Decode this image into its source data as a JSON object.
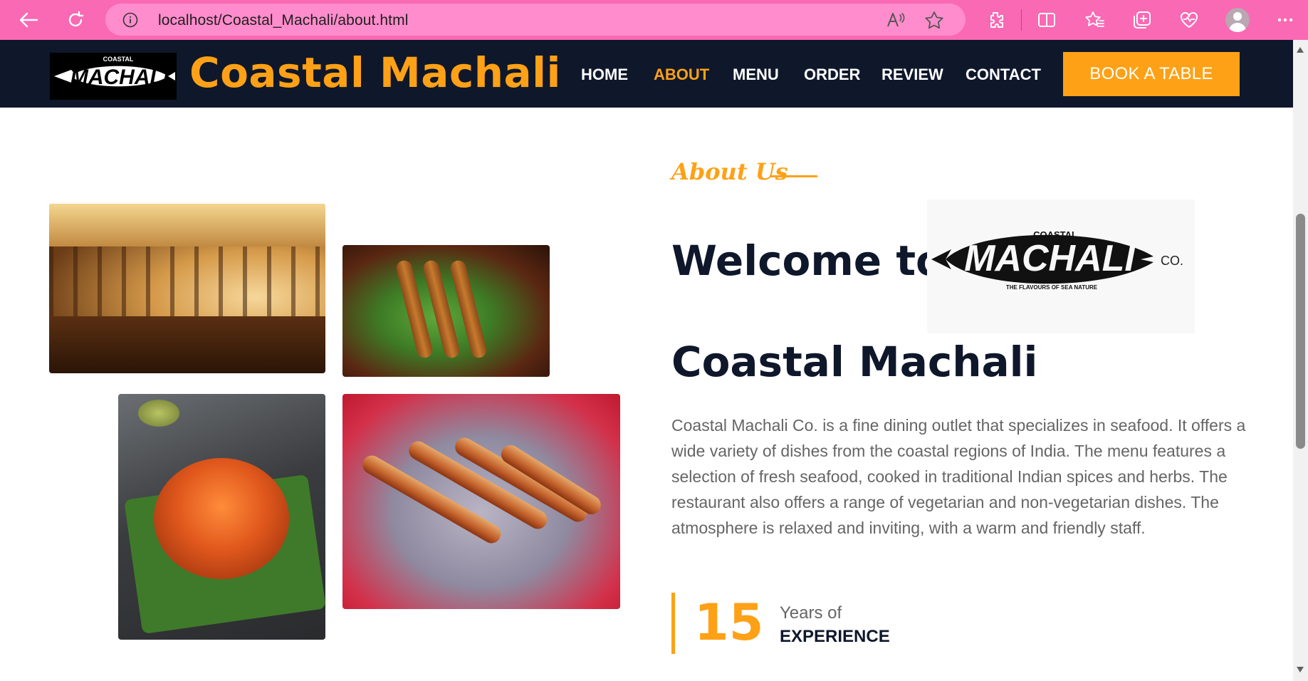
{
  "browser": {
    "url": "localhost/Coastal_Machali/about.html"
  },
  "navbar": {
    "brand": "Coastal Machali",
    "logo_text": "MACHALI",
    "logo_small_text": "COASTAL",
    "links": [
      "HOME",
      "ABOUT",
      "MENU",
      "ORDER",
      "REVIEW",
      "CONTACT"
    ],
    "active_link": "ABOUT",
    "book_button": "BOOK A TABLE"
  },
  "about": {
    "kicker": "About Us",
    "welcome": "Welcome to",
    "title": "Coastal Machali",
    "logo": {
      "top_text": "COASTAL",
      "main_text": "MACHALI",
      "suffix": "CO.",
      "tagline": "THE FLAVOURS OF SEA NATURE"
    },
    "description": "Coastal Machali Co. is a fine dining outlet that specializes in seafood. It offers a wide variety of dishes from the coastal regions of India. The menu features a selection of fresh seafood, cooked in traditional Indian spices and herbs. The restaurant also offers a range of vegetarian and non-vegetarian dishes. The atmosphere is relaxed and inviting, with a warm and friendly staff.",
    "experience": {
      "number": "15",
      "top": "Years of",
      "bottom": "EXPERIENCE"
    }
  },
  "colors": {
    "chrome": "#f969b4",
    "navbar": "#0f172b",
    "accent": "#fea116",
    "text_dark": "#0f172b",
    "text_body": "#666565"
  },
  "icons": [
    "back-icon",
    "refresh-icon",
    "info-icon",
    "read-aloud-icon",
    "favorite-star-icon",
    "extensions-icon",
    "split-screen-icon",
    "favorites-icon",
    "collections-icon",
    "health-icon",
    "profile-avatar",
    "more-icon"
  ]
}
